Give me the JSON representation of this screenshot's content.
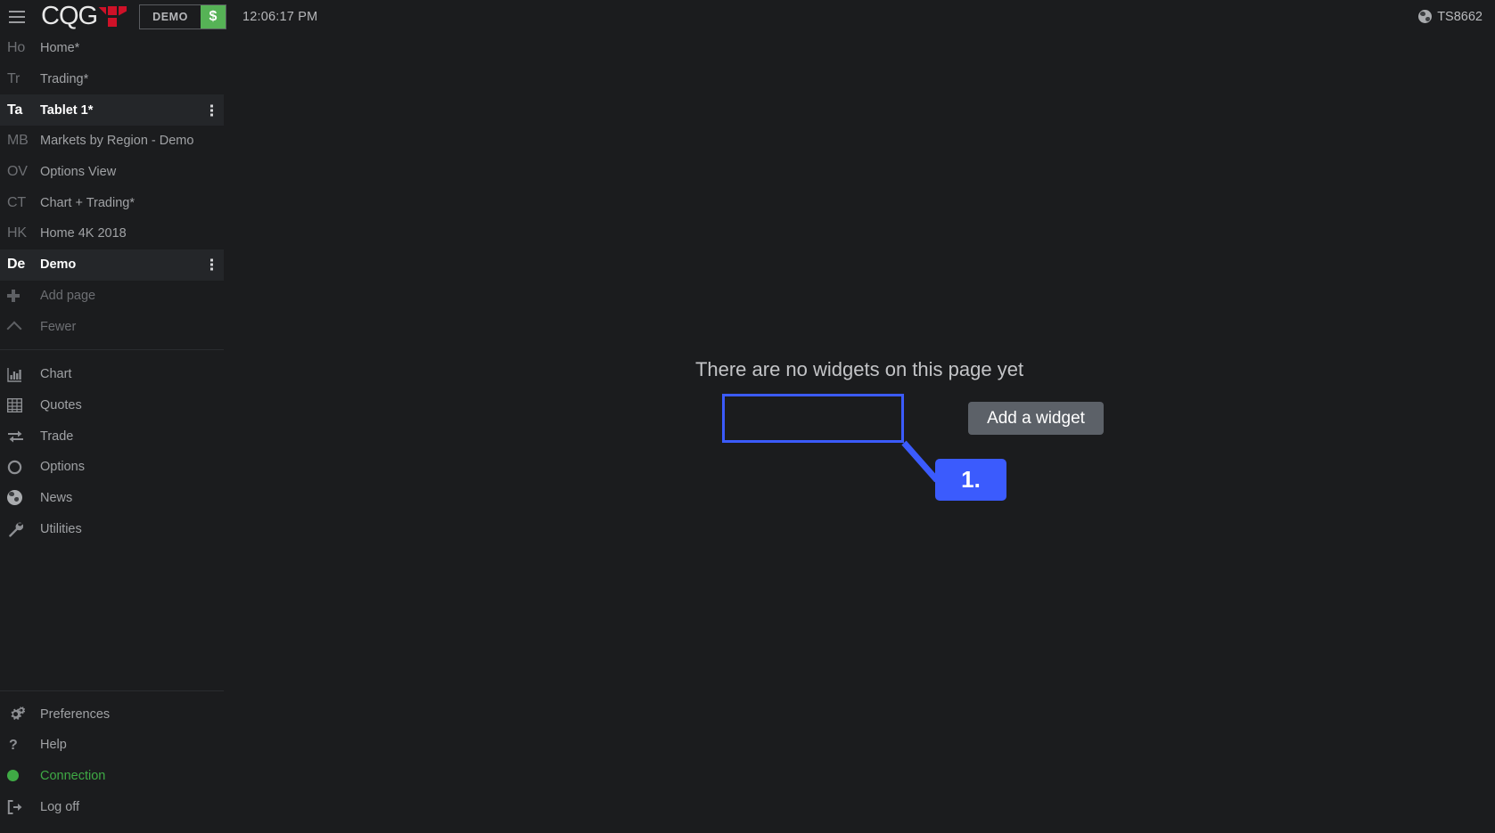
{
  "topbar": {
    "menu_icon": "hamburger-icon",
    "brand": "CQG",
    "mode_badge": "DEMO",
    "currency_symbol": "$",
    "clock": "12:06:17 PM",
    "account": "TS8662",
    "account_icon": "globe-icon"
  },
  "sidebar": {
    "pages": [
      {
        "abbr": "Ho",
        "label": "Home*",
        "active": false,
        "menu": false
      },
      {
        "abbr": "Tr",
        "label": "Trading*",
        "active": false,
        "menu": false
      },
      {
        "abbr": "Ta",
        "label": "Tablet 1*",
        "active": true,
        "menu": true
      },
      {
        "abbr": "MB",
        "label": "Markets by Region - Demo",
        "active": false,
        "menu": false
      },
      {
        "abbr": "OV",
        "label": "Options View",
        "active": false,
        "menu": false
      },
      {
        "abbr": "CT",
        "label": "Chart + Trading*",
        "active": false,
        "menu": false
      },
      {
        "abbr": "HK",
        "label": "Home 4K 2018",
        "active": false,
        "menu": false
      },
      {
        "abbr": "De",
        "label": "Demo",
        "active": true,
        "menu": true
      }
    ],
    "add_page": {
      "label": "Add page",
      "icon": "plus-icon"
    },
    "fewer": {
      "label": "Fewer",
      "icon": "chevron-up-icon"
    },
    "widgets": [
      {
        "label": "Chart",
        "icon": "bar-chart-icon"
      },
      {
        "label": "Quotes",
        "icon": "grid-table-icon"
      },
      {
        "label": "Trade",
        "icon": "exchange-arrows-icon"
      },
      {
        "label": "Options",
        "icon": "circle-icon"
      },
      {
        "label": "News",
        "icon": "globe-icon"
      },
      {
        "label": "Utilities",
        "icon": "wrench-icon"
      }
    ],
    "footer": [
      {
        "label": "Preferences",
        "icon": "gears-icon",
        "style": "normal"
      },
      {
        "label": "Help",
        "icon": "question-icon",
        "style": "normal"
      },
      {
        "label": "Connection",
        "icon": "green-dot-icon",
        "style": "green"
      },
      {
        "label": "Log off",
        "icon": "logout-icon",
        "style": "normal"
      }
    ]
  },
  "main": {
    "empty_message": "There are no widgets on this page yet",
    "add_widget_label": "Add a widget"
  },
  "annotation": {
    "step_label": "1.",
    "color": "#3b5bfd"
  }
}
